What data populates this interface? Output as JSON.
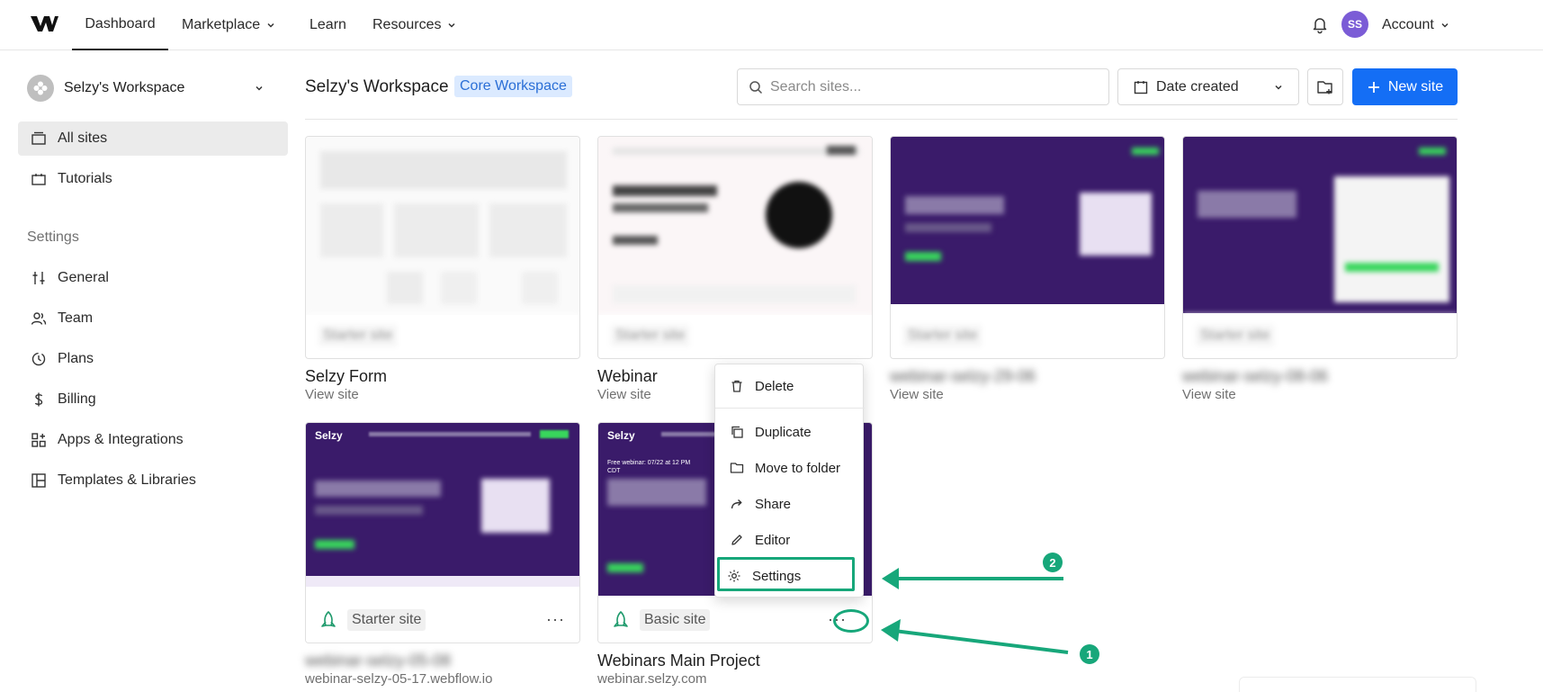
{
  "topnav": {
    "items": [
      {
        "label": "Dashboard"
      },
      {
        "label": "Marketplace"
      },
      {
        "label": "Learn"
      },
      {
        "label": "Resources"
      }
    ],
    "avatar_initials": "SS",
    "account_label": "Account"
  },
  "sidebar": {
    "workspace_name": "Selzy's Workspace",
    "items": [
      {
        "label": "All sites"
      },
      {
        "label": "Tutorials"
      }
    ],
    "settings_heading": "Settings",
    "settings_items": [
      {
        "label": "General"
      },
      {
        "label": "Team"
      },
      {
        "label": "Plans"
      },
      {
        "label": "Billing"
      },
      {
        "label": "Apps & Integrations"
      },
      {
        "label": "Templates & Libraries"
      }
    ]
  },
  "header": {
    "title": "Selzy's Workspace",
    "badge": "Core Workspace",
    "search_placeholder": "Search sites...",
    "sort_label": "Date created",
    "new_site_label": "New site"
  },
  "sites": [
    {
      "name": "Selzy Form",
      "sub": "View site",
      "type": "Starter site"
    },
    {
      "name": "Webinar",
      "sub": "View site",
      "type": "Starter site"
    },
    {
      "name": "webinar-selzy-29-06",
      "sub": "View site",
      "type": "Starter site"
    },
    {
      "name": "webinar-selzy-08-06",
      "sub": "View site",
      "type": "Starter site"
    },
    {
      "name": "webinar-selzy-05-08",
      "sub": "webinar-selzy-05-17.webflow.io",
      "type": "Starter site",
      "thumb_brand": "Selzy"
    },
    {
      "name": "Webinars Main Project",
      "sub": "webinar.selzy.com",
      "type": "Basic site",
      "thumb_brand": "Selzy",
      "thumb_text": "Free webinar: 07/22 at 12 PM CDT"
    }
  ],
  "context_menu": {
    "items": [
      {
        "label": "Delete"
      },
      {
        "label": "Duplicate"
      },
      {
        "label": "Move to folder"
      },
      {
        "label": "Share"
      },
      {
        "label": "Editor"
      },
      {
        "label": "Settings"
      }
    ]
  },
  "annotations": {
    "step1": "1",
    "step2": "2",
    "color": "#17a77a"
  },
  "colors": {
    "accent": "#146ef5",
    "badge_bg": "#dbeaff",
    "thumb_purple": "#3a1b6a",
    "annotation_green": "#17a77a"
  }
}
